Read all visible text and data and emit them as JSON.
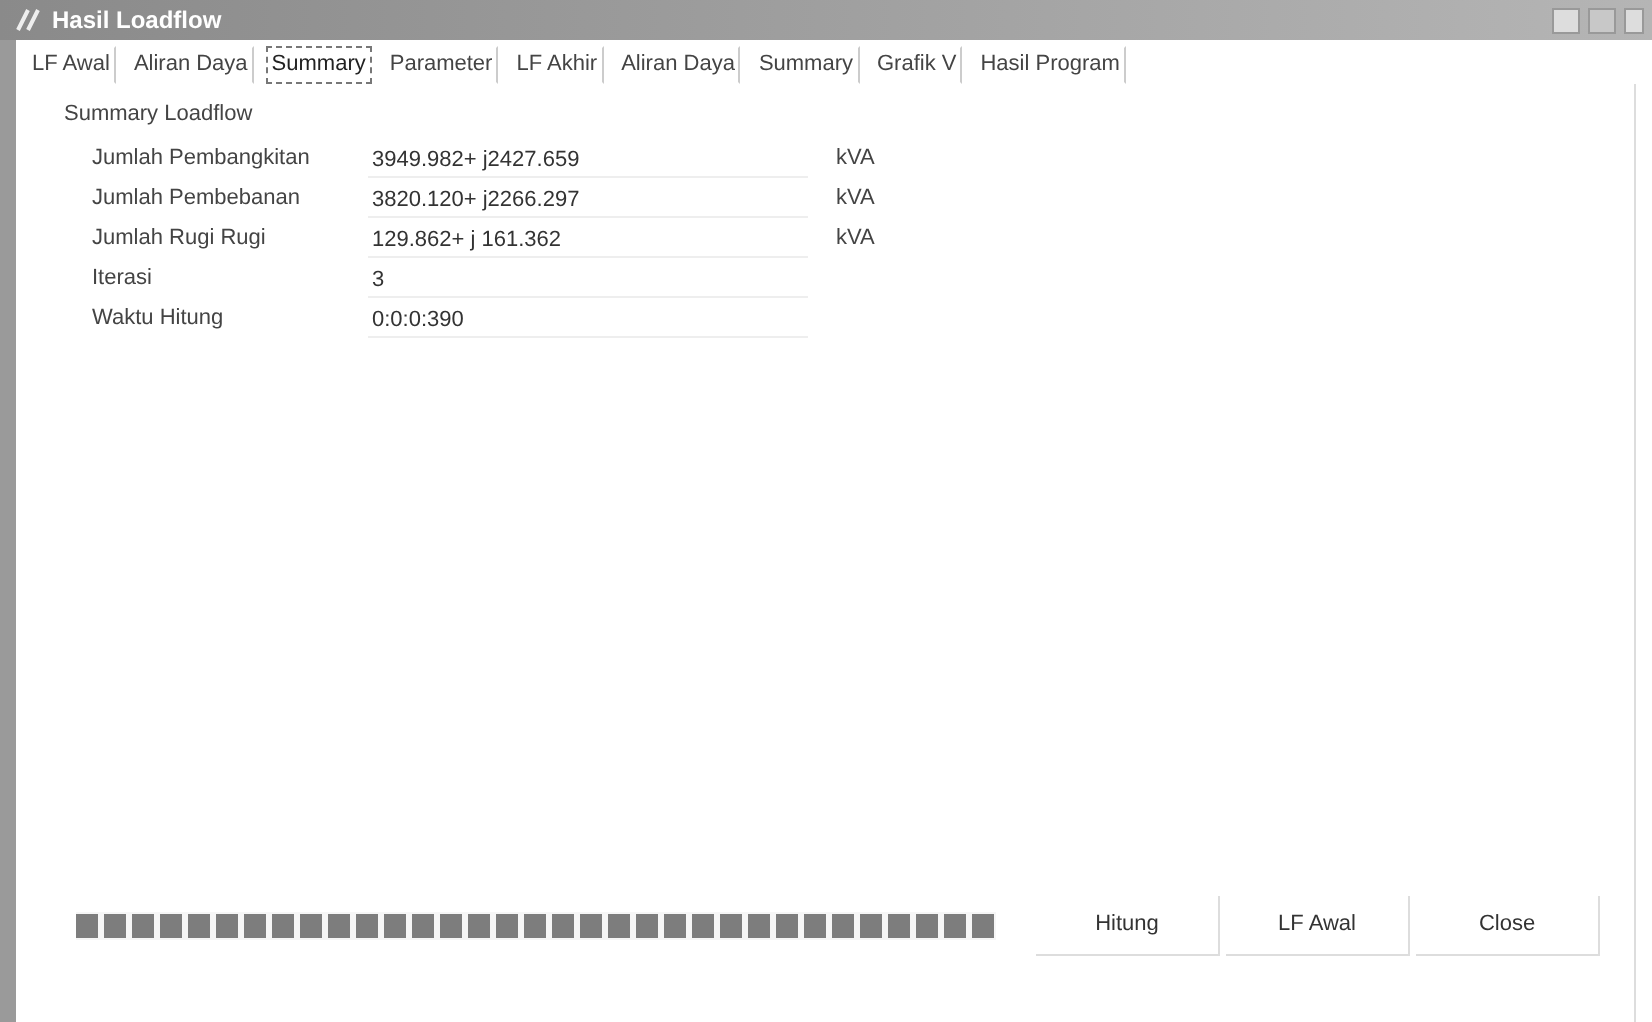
{
  "window": {
    "title": "Hasil Loadflow"
  },
  "tabs": [
    {
      "label": "LF Awal",
      "selected": false
    },
    {
      "label": "Aliran Daya",
      "selected": false
    },
    {
      "label": "Summary",
      "selected": true
    },
    {
      "label": "Parameter",
      "selected": false
    },
    {
      "label": "LF Akhir",
      "selected": false
    },
    {
      "label": "Aliran Daya",
      "selected": false
    },
    {
      "label": "Summary",
      "selected": false
    },
    {
      "label": "Grafik V",
      "selected": false
    },
    {
      "label": "Hasil Program",
      "selected": false
    }
  ],
  "summary": {
    "title": "Summary Loadflow",
    "rows": [
      {
        "label": "Jumlah Pembangkitan",
        "value": "3949.982+ j2427.659",
        "unit": "kVA"
      },
      {
        "label": "Jumlah Pembebanan",
        "value": "3820.120+ j2266.297",
        "unit": "kVA"
      },
      {
        "label": "Jumlah Rugi Rugi",
        "value": "129.862+ j 161.362",
        "unit": "kVA"
      },
      {
        "label": "Iterasi",
        "value": "3"
      },
      {
        "label": "Waktu Hitung",
        "value": "0:0:0:390"
      }
    ]
  },
  "progress": {
    "level": 1
  },
  "buttons": [
    "Hitung",
    "LF Awal",
    "Close"
  ]
}
